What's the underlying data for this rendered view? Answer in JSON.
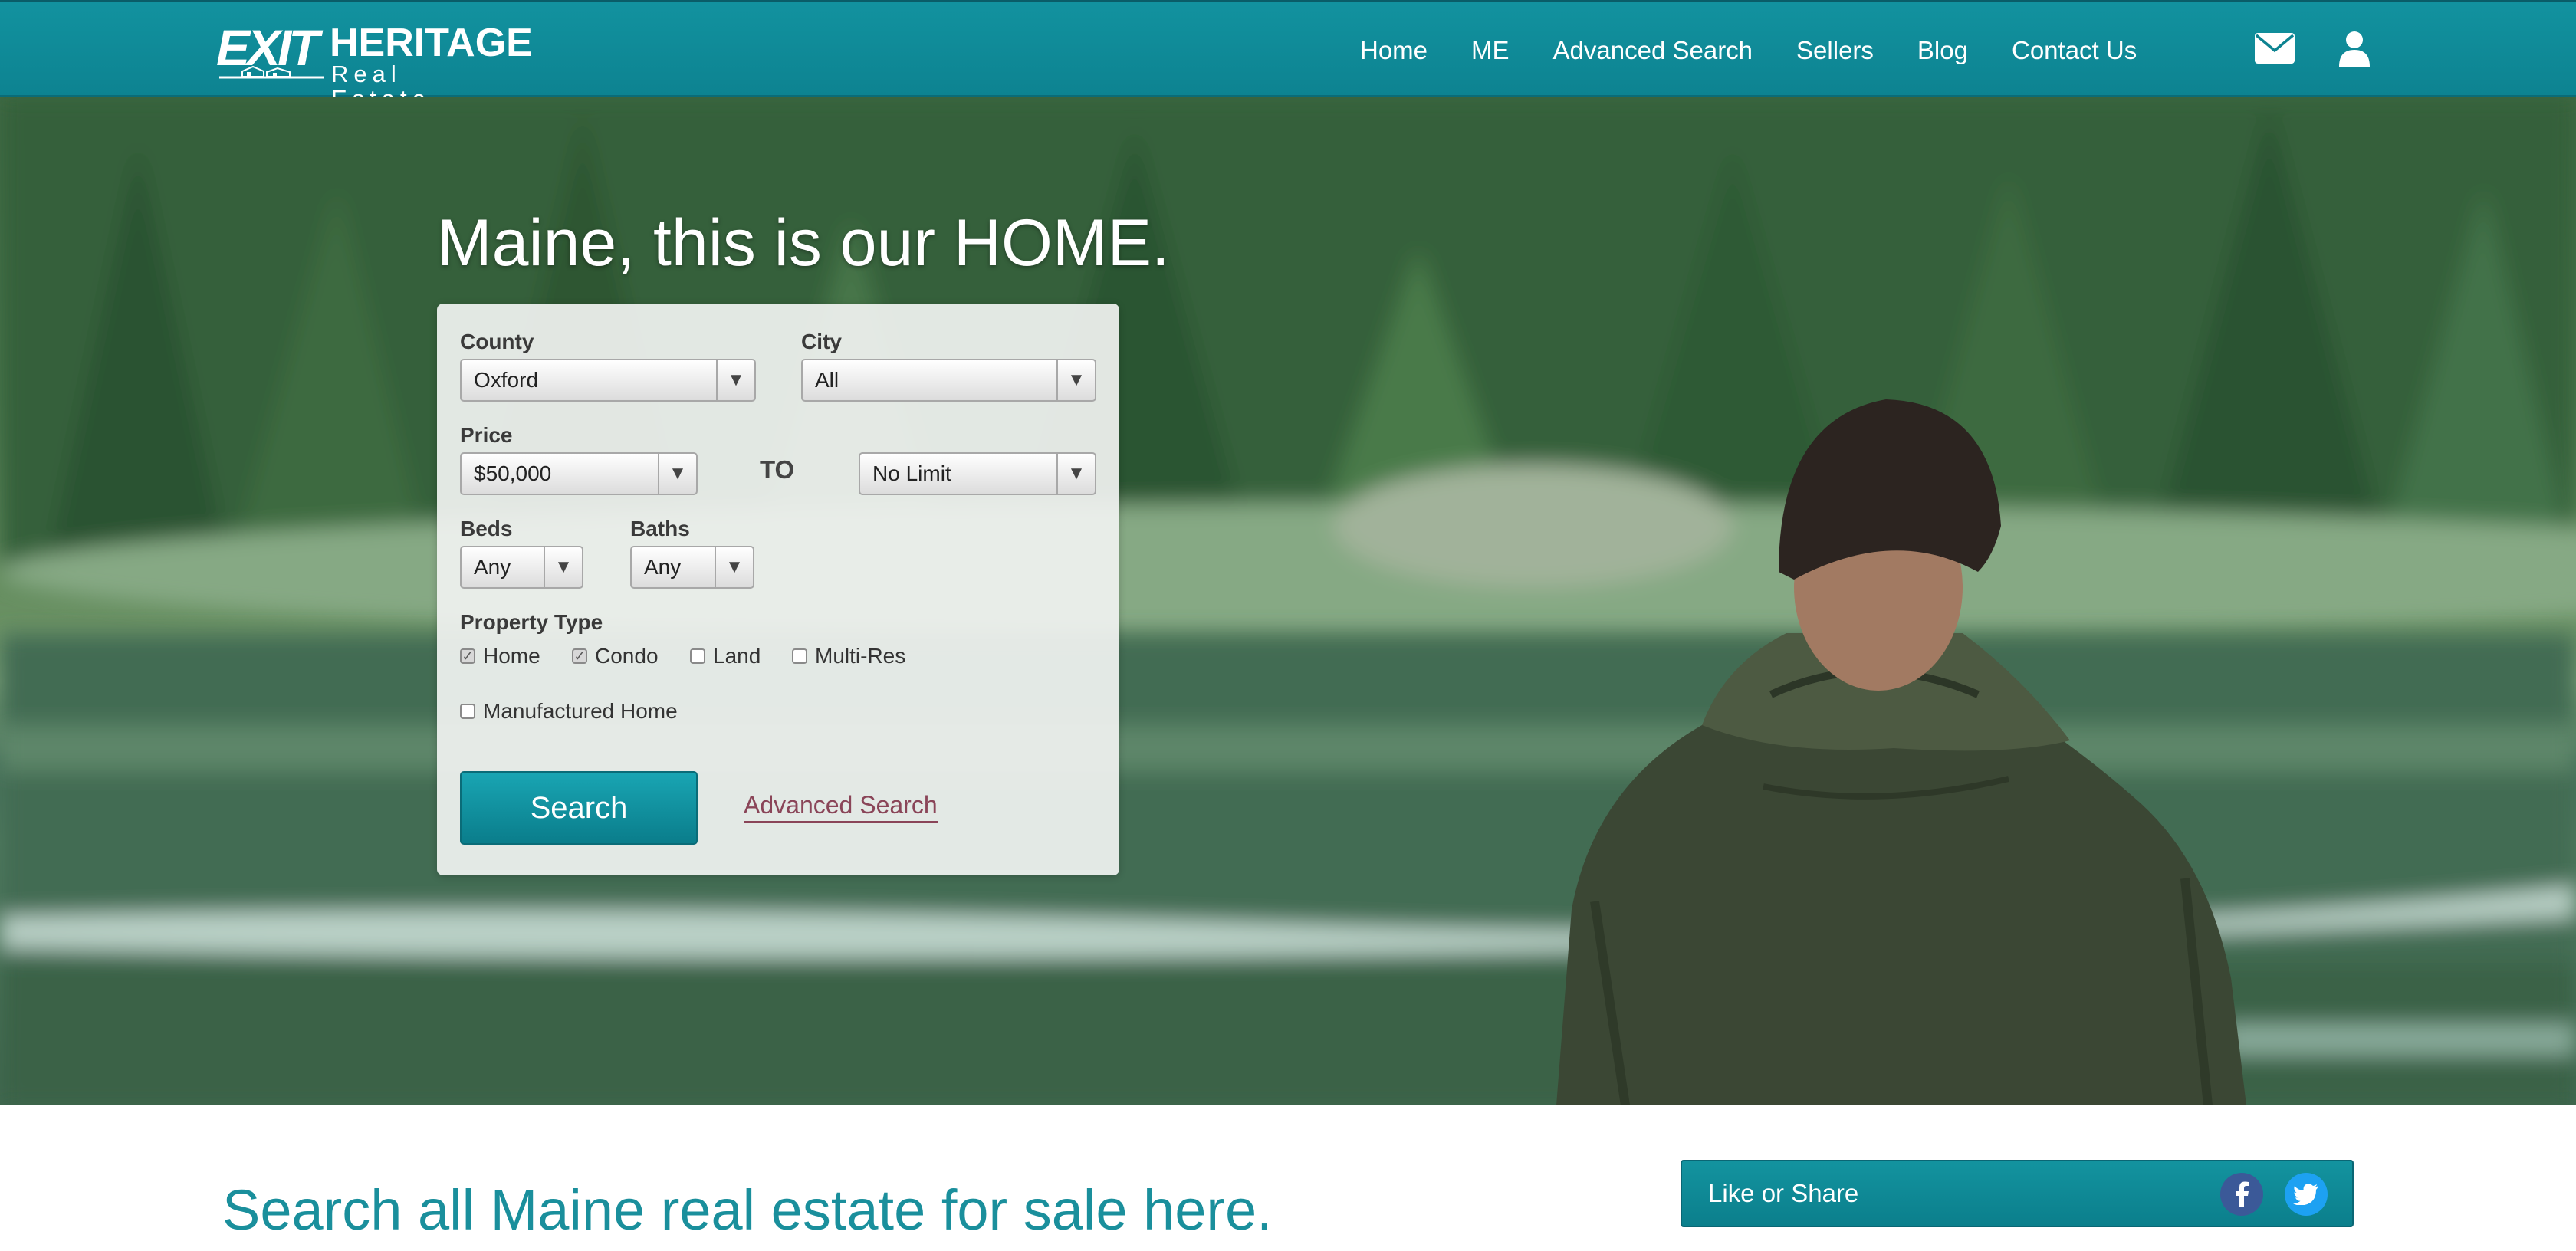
{
  "brand": {
    "logo_exit": "EXIT",
    "logo_heritage": "HERITAGE",
    "logo_real_estate": "Real Estate"
  },
  "nav": {
    "items": [
      {
        "label": "Home"
      },
      {
        "label": "ME"
      },
      {
        "label": "Advanced Search"
      },
      {
        "label": "Sellers"
      },
      {
        "label": "Blog"
      },
      {
        "label": "Contact Us"
      }
    ],
    "icons": [
      "envelope-icon",
      "user-icon"
    ]
  },
  "hero": {
    "title": "Maine, this is our HOME."
  },
  "search_form": {
    "county_label": "County",
    "county_value": "Oxford",
    "city_label": "City",
    "city_value": "All",
    "price_label": "Price",
    "price_min": "$50,000",
    "to_label": "TO",
    "price_max": "No Limit",
    "beds_label": "Beds",
    "beds_value": "Any",
    "baths_label": "Baths",
    "baths_value": "Any",
    "property_type_label": "Property Type",
    "property_types": [
      {
        "label": "Home",
        "checked": true
      },
      {
        "label": "Condo",
        "checked": true
      },
      {
        "label": "Land",
        "checked": false
      },
      {
        "label": "Multi-Res",
        "checked": false
      },
      {
        "label": "Manufactured Home",
        "checked": false
      }
    ],
    "search_button": "Search",
    "advanced_search_link": "Advanced Search"
  },
  "tagline": "Search all Maine real estate for sale here.",
  "share": {
    "label": "Like or Share",
    "icons": [
      "facebook-icon",
      "twitter-icon"
    ]
  },
  "colors": {
    "brand_teal": "#12929f",
    "tagline_teal": "#1a8f9c",
    "link_mauve": "#8a4558",
    "facebook": "#3b5998",
    "twitter": "#1da1f2"
  }
}
